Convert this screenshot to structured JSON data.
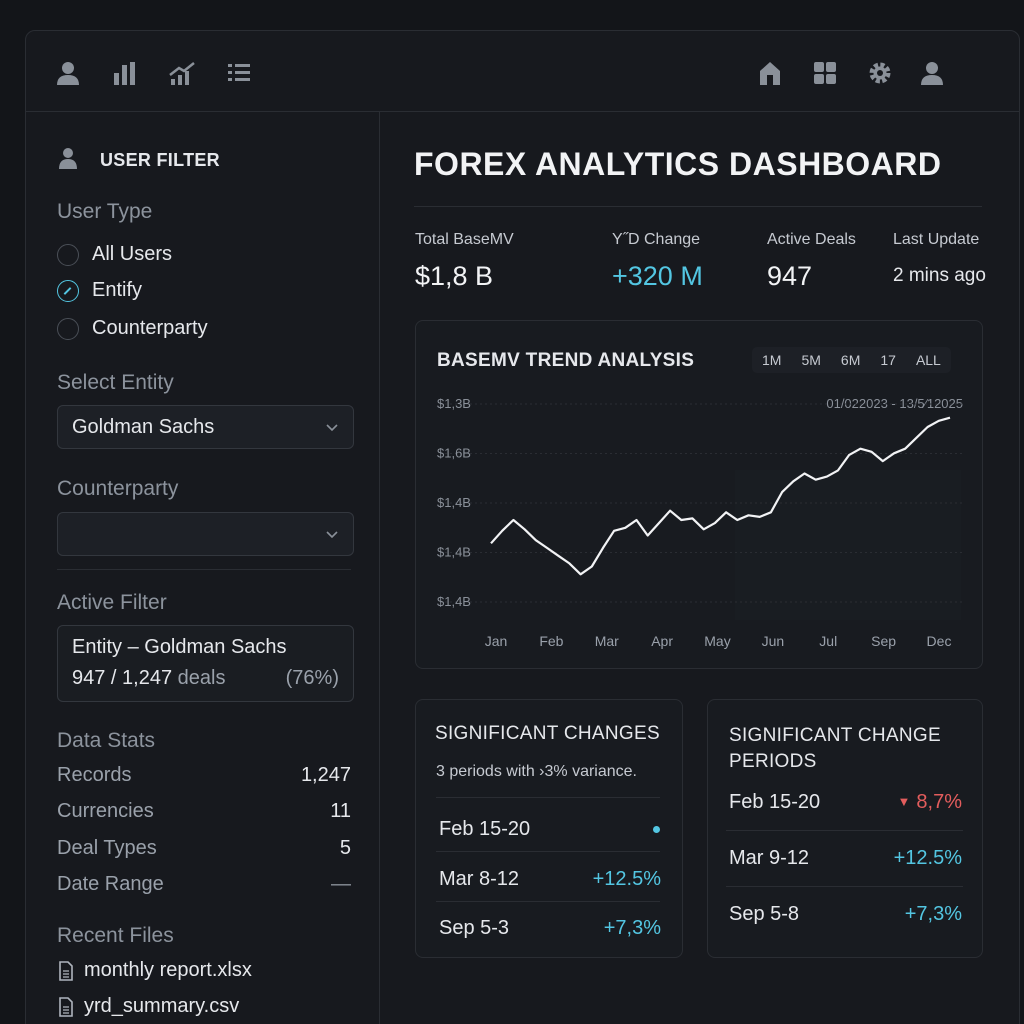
{
  "topbar": {
    "left_icons": [
      "user-icon",
      "bar-chart-icon",
      "trend-chart-icon",
      "list-icon"
    ],
    "right_icons": [
      "home-icon",
      "grid-icon",
      "gear-icon",
      "profile-icon"
    ]
  },
  "sidebar": {
    "user_filter_title": "USER FILTER",
    "user_type_label": "User Type",
    "user_types": [
      {
        "label": "All Users",
        "checked": false
      },
      {
        "label": "Entify",
        "checked": true
      },
      {
        "label": "Counterparty",
        "checked": false
      }
    ],
    "select_entity_label": "Select Entity",
    "entity_value": "Goldman Sachs",
    "counterparty_label": "Counterparty",
    "counterparty_value": "",
    "active_filter_label": "Active Filter",
    "active_filter_line1": "Entity – Goldman Sachs",
    "active_filter_count": "947 / 1,247",
    "active_filter_unit": "deals",
    "active_filter_pct": "(76%)",
    "data_stats_label": "Data Stats",
    "stats": [
      {
        "key": "Records",
        "value": "1,247"
      },
      {
        "key": "Currencies",
        "value": "11"
      },
      {
        "key": "Deal Types",
        "value": "5"
      },
      {
        "key": "Date Range",
        "value": "—"
      }
    ],
    "recent_files_label": "Recent Files",
    "files": [
      "monthly report.xlsx",
      "yrd_summary.csv"
    ]
  },
  "main": {
    "title": "FOREX ANALYTICS DASHBOARD",
    "kpis": [
      {
        "label": "Total BaseMV",
        "value": "$1,8 B"
      },
      {
        "label": "Y˝D Change",
        "value": "+320 M"
      },
      {
        "label": "Active Deals",
        "value": "947"
      },
      {
        "label": "Last Update",
        "value": "2 mins ago"
      }
    ],
    "trend": {
      "title": "BASEMV TREND ANALYSIS",
      "ranges": [
        "1M",
        "5M",
        "6M",
        "17",
        "ALL"
      ],
      "date_range": "01/022023 - 13/5⁄12025"
    },
    "sig_changes": {
      "title": "SIGNIFICANT CHANGES",
      "subtitle": "3 periods with ›3% variance.",
      "rows": [
        {
          "period": "Feb 15-20",
          "value": "",
          "dot": true
        },
        {
          "period": "Mar 8-12",
          "value": "+12.5%"
        },
        {
          "period": "Sep 5-3",
          "value": "+7,3%"
        }
      ]
    },
    "sig_periods": {
      "title_line1": "SIGNIFICANT CHANGE",
      "title_line2": "PERIODS",
      "rows": [
        {
          "period": "Feb 15-20",
          "value": "8,7%",
          "direction": "down"
        },
        {
          "period": "Mar 9-12",
          "value": "+12.5%",
          "direction": "up"
        },
        {
          "period": "Sep 5-8",
          "value": "+7,3%",
          "direction": "up"
        }
      ]
    }
  },
  "colors": {
    "accent": "#53c6e2",
    "negative": "#e35d5d",
    "background": "#131519"
  },
  "chart_data": {
    "type": "line",
    "title": "BASEMV TREND ANALYSIS",
    "categories": [
      "Jan",
      "Feb",
      "Mar",
      "Apr",
      "May",
      "Jun",
      "Jul",
      "Sep",
      "Dec"
    ],
    "y_tick_labels": [
      "$1,3B",
      "$1,6B",
      "$1,4B",
      "$1,4B",
      "$1,4B"
    ],
    "series": [
      {
        "values": [
          0.25,
          0.33,
          0.4,
          0.34,
          0.27,
          0.22,
          0.17,
          0.12,
          0.05,
          0.1,
          0.22,
          0.33,
          0.35,
          0.4,
          0.3,
          0.38,
          0.46,
          0.4,
          0.41,
          0.34,
          0.38,
          0.45,
          0.4,
          0.43,
          0.42,
          0.45,
          0.58,
          0.65,
          0.7,
          0.66,
          0.68,
          0.72,
          0.82,
          0.86,
          0.84,
          0.78,
          0.83,
          0.86,
          0.93,
          1.0,
          1.04,
          1.06
        ]
      }
    ],
    "grid": true
  }
}
